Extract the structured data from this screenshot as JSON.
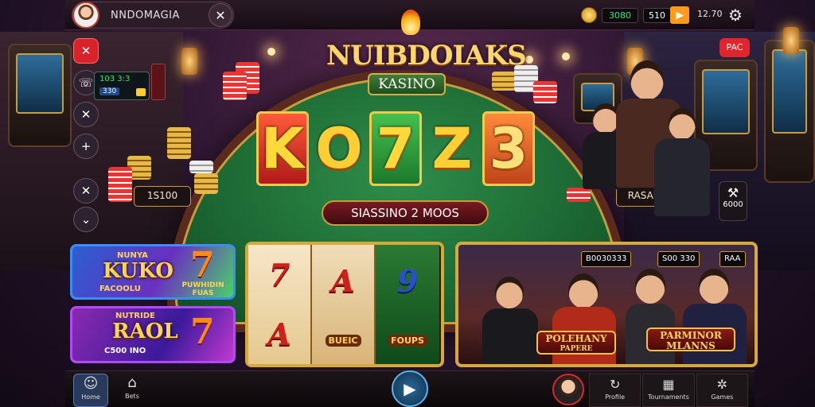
{
  "header": {
    "user_name": "NNDOMAGIA",
    "balance_green": "3080",
    "balance_white": "510",
    "level": "12.70"
  },
  "left_panel": {
    "jackpot_top": "103 3:3",
    "jackpot_bottom": "330"
  },
  "table": {
    "logo_title": "NUIBDOIAKS",
    "logo_sub": "KASINO",
    "letters": [
      "K",
      "O",
      "7",
      "Z",
      "3"
    ],
    "promo": "SIASSINO 2 MOOS",
    "left_bet": "1S100",
    "right_label": "RASAIN"
  },
  "right_panel": {
    "pac_button": "PAC",
    "tools_value": "6000"
  },
  "cards": [
    {
      "title": "KUKO",
      "top_small": "NUNYA",
      "sub": "FACOOLU",
      "badge": "PUWHIDIN FUAS"
    },
    {
      "title": "RAOL",
      "top_small": "NUTRIDE",
      "sub": "C500 INO",
      "badge": ""
    }
  ],
  "reels": [
    {
      "top": "7",
      "bottom": "A"
    },
    {
      "top": "A",
      "bottom": "BUEIC"
    },
    {
      "top": "9",
      "bottom": "FOUPS"
    }
  ],
  "banner": {
    "stat_left": "B0030333",
    "stat_mid": "S00 330",
    "stat_right": "RAA",
    "label_left_1": "POLEHANY",
    "label_left_2": "PAPERE",
    "label_right_1": "PARMINOR",
    "label_right_2": "MLANNS"
  },
  "nav": {
    "home": "Home",
    "bets": "Bets",
    "profile": "Profile",
    "tournaments": "Tournaments",
    "games": "Games"
  }
}
